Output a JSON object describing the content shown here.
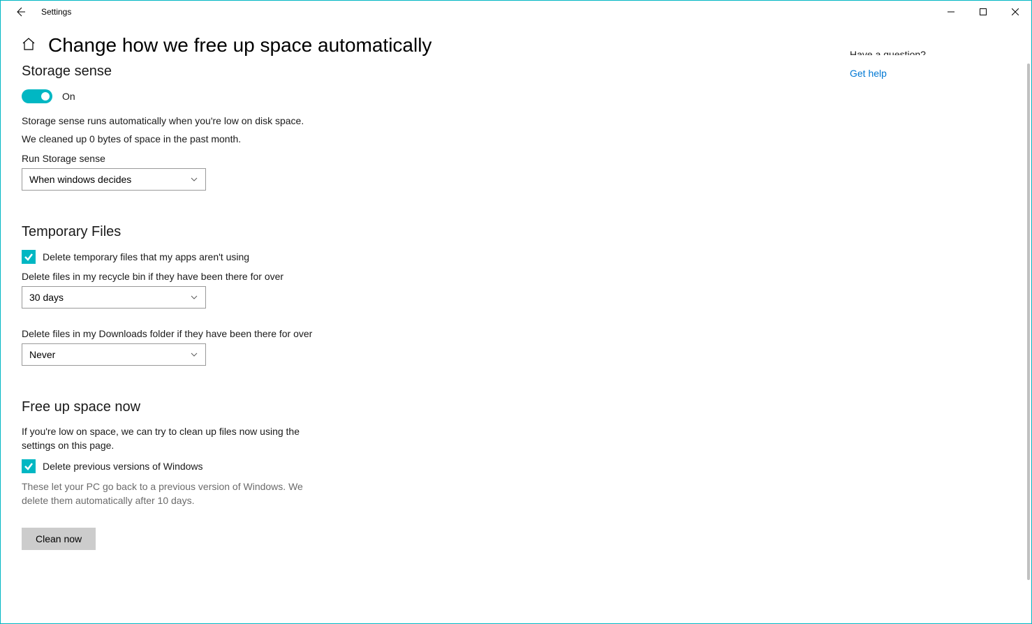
{
  "titlebar": {
    "title": "Settings"
  },
  "page": {
    "title": "Change how we free up space automatically"
  },
  "aside": {
    "cutoff_text": "Have a question?",
    "get_help": "Get help"
  },
  "storage_sense": {
    "heading": "Storage sense",
    "toggle_label": "On",
    "description_line1": "Storage sense runs automatically when you're low on disk space.",
    "description_line2": "We cleaned up 0 bytes of space in the past month.",
    "run_label": "Run Storage sense",
    "run_value": "When windows decides"
  },
  "temporary_files": {
    "heading": "Temporary Files",
    "delete_temp_label": "Delete temporary files that my apps aren't using",
    "recycle_label": "Delete files in my recycle bin if they have been there for over",
    "recycle_value": "30 days",
    "downloads_label": "Delete files in my Downloads folder if they have been there for over",
    "downloads_value": "Never"
  },
  "free_up": {
    "heading": "Free up space now",
    "description": "If you're low on space, we can try to clean up files now using the settings on this page.",
    "delete_prev_label": "Delete previous versions of Windows",
    "prev_description": "These let your PC go back to a previous version of Windows. We delete them automatically after 10 days.",
    "clean_button": "Clean now"
  }
}
